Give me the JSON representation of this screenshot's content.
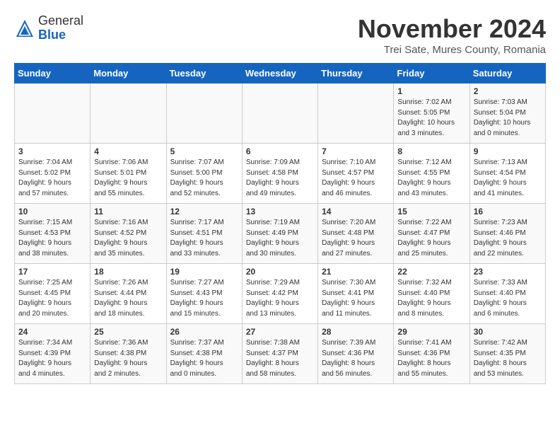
{
  "header": {
    "logo_general": "General",
    "logo_blue": "Blue",
    "month_title": "November 2024",
    "subtitle": "Trei Sate, Mures County, Romania"
  },
  "days_of_week": [
    "Sunday",
    "Monday",
    "Tuesday",
    "Wednesday",
    "Thursday",
    "Friday",
    "Saturday"
  ],
  "weeks": [
    [
      {
        "day": "",
        "info": ""
      },
      {
        "day": "",
        "info": ""
      },
      {
        "day": "",
        "info": ""
      },
      {
        "day": "",
        "info": ""
      },
      {
        "day": "",
        "info": ""
      },
      {
        "day": "1",
        "info": "Sunrise: 7:02 AM\nSunset: 5:05 PM\nDaylight: 10 hours\nand 3 minutes."
      },
      {
        "day": "2",
        "info": "Sunrise: 7:03 AM\nSunset: 5:04 PM\nDaylight: 10 hours\nand 0 minutes."
      }
    ],
    [
      {
        "day": "3",
        "info": "Sunrise: 7:04 AM\nSunset: 5:02 PM\nDaylight: 9 hours\nand 57 minutes."
      },
      {
        "day": "4",
        "info": "Sunrise: 7:06 AM\nSunset: 5:01 PM\nDaylight: 9 hours\nand 55 minutes."
      },
      {
        "day": "5",
        "info": "Sunrise: 7:07 AM\nSunset: 5:00 PM\nDaylight: 9 hours\nand 52 minutes."
      },
      {
        "day": "6",
        "info": "Sunrise: 7:09 AM\nSunset: 4:58 PM\nDaylight: 9 hours\nand 49 minutes."
      },
      {
        "day": "7",
        "info": "Sunrise: 7:10 AM\nSunset: 4:57 PM\nDaylight: 9 hours\nand 46 minutes."
      },
      {
        "day": "8",
        "info": "Sunrise: 7:12 AM\nSunset: 4:55 PM\nDaylight: 9 hours\nand 43 minutes."
      },
      {
        "day": "9",
        "info": "Sunrise: 7:13 AM\nSunset: 4:54 PM\nDaylight: 9 hours\nand 41 minutes."
      }
    ],
    [
      {
        "day": "10",
        "info": "Sunrise: 7:15 AM\nSunset: 4:53 PM\nDaylight: 9 hours\nand 38 minutes."
      },
      {
        "day": "11",
        "info": "Sunrise: 7:16 AM\nSunset: 4:52 PM\nDaylight: 9 hours\nand 35 minutes."
      },
      {
        "day": "12",
        "info": "Sunrise: 7:17 AM\nSunset: 4:51 PM\nDaylight: 9 hours\nand 33 minutes."
      },
      {
        "day": "13",
        "info": "Sunrise: 7:19 AM\nSunset: 4:49 PM\nDaylight: 9 hours\nand 30 minutes."
      },
      {
        "day": "14",
        "info": "Sunrise: 7:20 AM\nSunset: 4:48 PM\nDaylight: 9 hours\nand 27 minutes."
      },
      {
        "day": "15",
        "info": "Sunrise: 7:22 AM\nSunset: 4:47 PM\nDaylight: 9 hours\nand 25 minutes."
      },
      {
        "day": "16",
        "info": "Sunrise: 7:23 AM\nSunset: 4:46 PM\nDaylight: 9 hours\nand 22 minutes."
      }
    ],
    [
      {
        "day": "17",
        "info": "Sunrise: 7:25 AM\nSunset: 4:45 PM\nDaylight: 9 hours\nand 20 minutes."
      },
      {
        "day": "18",
        "info": "Sunrise: 7:26 AM\nSunset: 4:44 PM\nDaylight: 9 hours\nand 18 minutes."
      },
      {
        "day": "19",
        "info": "Sunrise: 7:27 AM\nSunset: 4:43 PM\nDaylight: 9 hours\nand 15 minutes."
      },
      {
        "day": "20",
        "info": "Sunrise: 7:29 AM\nSunset: 4:42 PM\nDaylight: 9 hours\nand 13 minutes."
      },
      {
        "day": "21",
        "info": "Sunrise: 7:30 AM\nSunset: 4:41 PM\nDaylight: 9 hours\nand 11 minutes."
      },
      {
        "day": "22",
        "info": "Sunrise: 7:32 AM\nSunset: 4:40 PM\nDaylight: 9 hours\nand 8 minutes."
      },
      {
        "day": "23",
        "info": "Sunrise: 7:33 AM\nSunset: 4:40 PM\nDaylight: 9 hours\nand 6 minutes."
      }
    ],
    [
      {
        "day": "24",
        "info": "Sunrise: 7:34 AM\nSunset: 4:39 PM\nDaylight: 9 hours\nand 4 minutes."
      },
      {
        "day": "25",
        "info": "Sunrise: 7:36 AM\nSunset: 4:38 PM\nDaylight: 9 hours\nand 2 minutes."
      },
      {
        "day": "26",
        "info": "Sunrise: 7:37 AM\nSunset: 4:38 PM\nDaylight: 9 hours\nand 0 minutes."
      },
      {
        "day": "27",
        "info": "Sunrise: 7:38 AM\nSunset: 4:37 PM\nDaylight: 8 hours\nand 58 minutes."
      },
      {
        "day": "28",
        "info": "Sunrise: 7:39 AM\nSunset: 4:36 PM\nDaylight: 8 hours\nand 56 minutes."
      },
      {
        "day": "29",
        "info": "Sunrise: 7:41 AM\nSunset: 4:36 PM\nDaylight: 8 hours\nand 55 minutes."
      },
      {
        "day": "30",
        "info": "Sunrise: 7:42 AM\nSunset: 4:35 PM\nDaylight: 8 hours\nand 53 minutes."
      }
    ]
  ]
}
